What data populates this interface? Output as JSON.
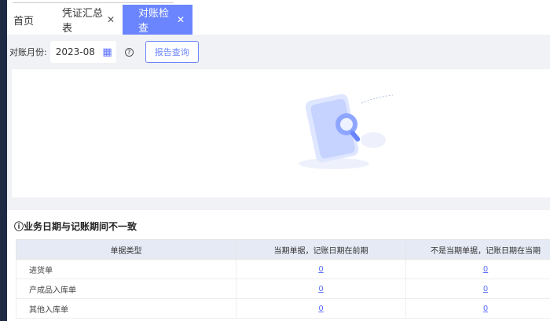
{
  "tabs": [
    {
      "label": "首页",
      "closable": false
    },
    {
      "label": "凭证汇总表",
      "closable": true
    },
    {
      "label": "对账检查",
      "closable": true,
      "active": true
    }
  ],
  "toolbar": {
    "month_label": "对账月份:",
    "month_value": "2023-08",
    "query_button": "报告查询"
  },
  "section": {
    "title": "业务日期与记账期间不一致"
  },
  "table": {
    "headers": [
      "单据类型",
      "当期单据，记账日期在前期",
      "不是当期单据，记账日期在当期"
    ],
    "rows": [
      [
        "进货单",
        "0",
        "0"
      ],
      [
        "产成品入库单",
        "0",
        "0"
      ],
      [
        "其他入库单",
        "0",
        "0"
      ]
    ]
  },
  "colors": {
    "accent": "#6b85ff"
  }
}
